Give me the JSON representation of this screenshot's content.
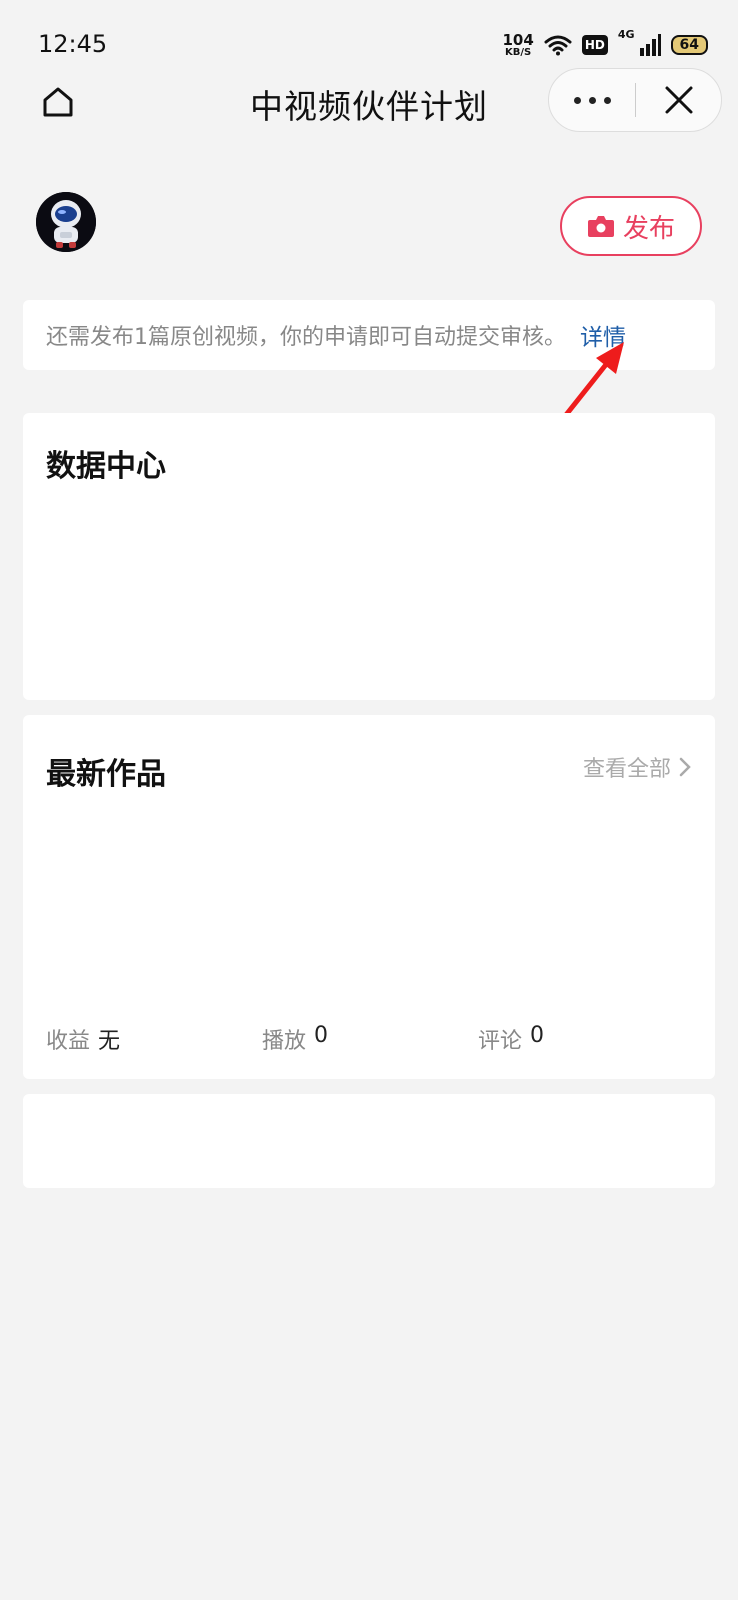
{
  "status_bar": {
    "time": "12:45",
    "net_speed_value": "104",
    "net_speed_unit": "KB/S",
    "hd_badge": "HD",
    "signal_label": "4G",
    "battery": "64"
  },
  "nav": {
    "title": "中视频伙伴计划"
  },
  "header": {
    "publish_label": "发布"
  },
  "notice": {
    "text": "还需发布1篇原创视频，你的申请即可自动提交审核。",
    "link_label": "详情"
  },
  "data_center": {
    "title": "数据中心"
  },
  "latest_works": {
    "title": "最新作品",
    "view_all_label": "查看全部",
    "stats": [
      {
        "label": "收益",
        "value": "无"
      },
      {
        "label": "播放",
        "value": "0"
      },
      {
        "label": "评论",
        "value": "0"
      }
    ]
  },
  "colors": {
    "accent": "#e8405f",
    "link": "#1f5ea8",
    "background": "#f3f3f3"
  }
}
